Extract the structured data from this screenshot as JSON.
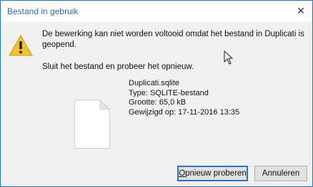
{
  "window": {
    "title": "Bestand in gebruik",
    "close_glyph": "✕"
  },
  "dialog": {
    "icon": "warning-icon",
    "message": "De bewerking kan niet worden voltooid omdat het bestand in Duplicati is geopend.",
    "instruction": "Sluit het bestand en probeer het opnieuw."
  },
  "file": {
    "icon": "document-icon",
    "name": "Duplicati.sqlite",
    "type": "Type: SQLITE-bestand",
    "size": "Grootte: 65,0 kB",
    "modified": "Gewijzigd op: 17-11-2016 13:35"
  },
  "buttons": {
    "retry_mnemonic": "O",
    "retry_rest": "pnieuw proberen",
    "cancel": "Annuleren"
  },
  "colors": {
    "accent": "#1f74bf",
    "title_text": "#2e6aa8",
    "warning": "#f2c12e"
  }
}
